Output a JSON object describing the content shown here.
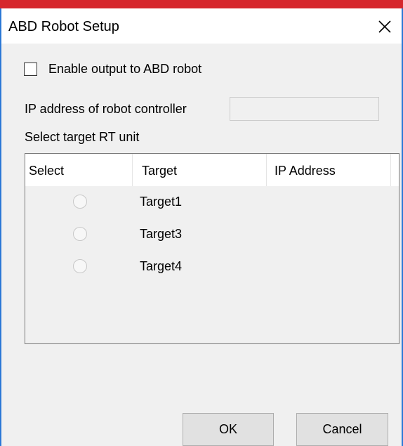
{
  "window": {
    "title": "ABD Robot Setup"
  },
  "options": {
    "enable_label": "Enable output to ABD robot",
    "enable_checked": false,
    "ip_label": "IP address of robot controller",
    "ip_value": ""
  },
  "targets": {
    "section_label": "Select target RT unit",
    "columns": [
      "Select",
      "Target",
      "IP Address"
    ],
    "rows": [
      {
        "target": "Target1",
        "ip": "",
        "selected": false
      },
      {
        "target": "Target3",
        "ip": "",
        "selected": false
      },
      {
        "target": "Target4",
        "ip": "",
        "selected": false
      }
    ]
  },
  "buttons": {
    "ok": "OK",
    "cancel": "Cancel"
  },
  "colors": {
    "accent_top": "#d6262c",
    "window_border": "#2b78d6"
  }
}
